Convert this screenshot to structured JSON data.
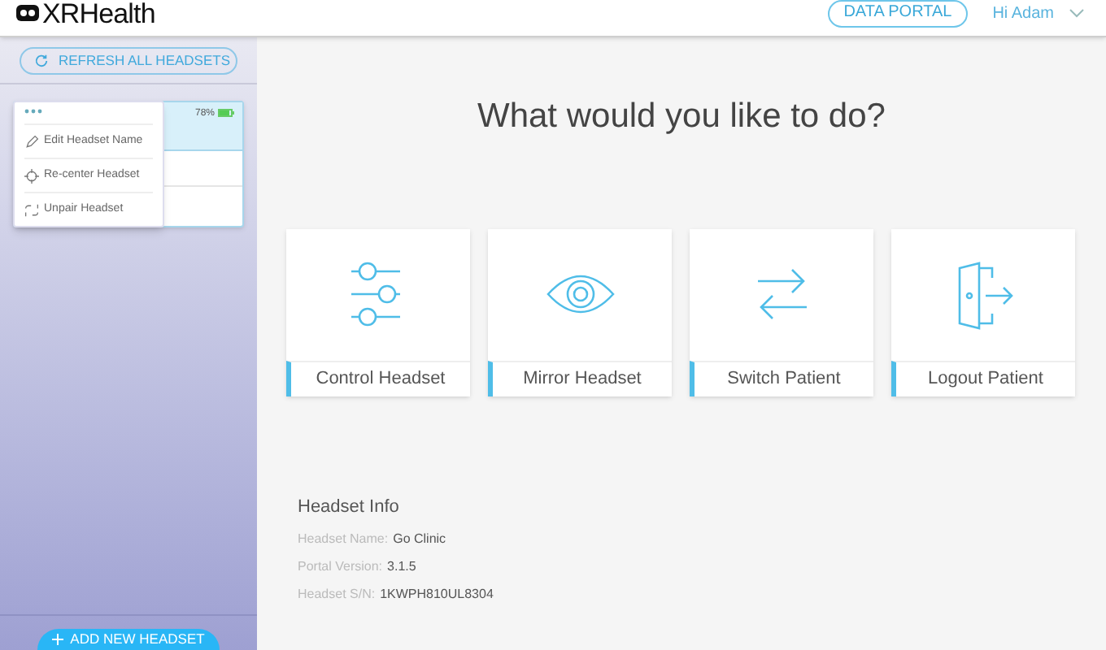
{
  "header": {
    "logo": "XRHealth",
    "data_portal": "DATA PORTAL",
    "user": "Hi Adam"
  },
  "sidebar": {
    "refresh_button": "REFRESH ALL HEADSETS",
    "headset": {
      "battery": "78%",
      "selected": true
    },
    "menu": [
      {
        "kind": "edit",
        "label": "Edit Headset Name"
      },
      {
        "kind": "recenter",
        "label": "Re-center Headset"
      },
      {
        "kind": "unpair",
        "label": "Unpair Headset"
      }
    ],
    "add_button": "ADD NEW HEADSET"
  },
  "main": {
    "title": "What would you like to do?",
    "actions": [
      {
        "kind": "control",
        "label": "Control Headset"
      },
      {
        "kind": "mirror",
        "label": "Mirror Headset"
      },
      {
        "kind": "switch",
        "label": "Switch Patient"
      },
      {
        "kind": "logout",
        "label": "Logout Patient"
      }
    ],
    "info": {
      "title": "Headset Info",
      "rows": [
        {
          "label": "Headset Name:",
          "value": "Go Clinic"
        },
        {
          "label": "Portal Version:",
          "value": "3.1.5"
        },
        {
          "label": "Headset S/N:",
          "value": "1KWPH810UL8304"
        }
      ]
    }
  }
}
